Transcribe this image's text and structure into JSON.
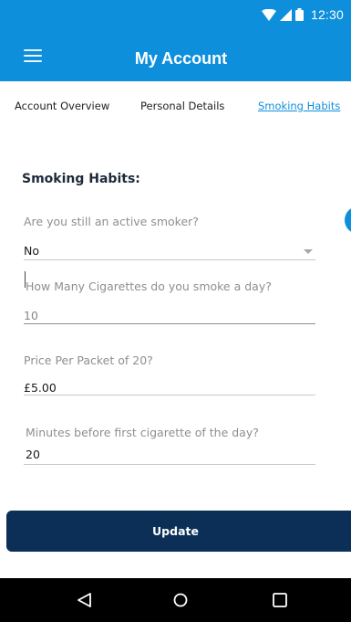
{
  "status_bar": {
    "time": "12:30",
    "icons": [
      "wifi-icon",
      "cellular-signal-icon",
      "battery-icon"
    ]
  },
  "app_bar": {
    "title": "My Account",
    "menu_icon": "hamburger-menu-icon"
  },
  "tabs": [
    {
      "label": "Account Overview",
      "active": false
    },
    {
      "label": "Personal Details",
      "active": false
    },
    {
      "label": "Smoking Habits",
      "active": true
    }
  ],
  "section": {
    "title": "Smoking Habits:"
  },
  "form": {
    "active_smoker": {
      "label": "Are you still an active smoker?",
      "value": "No"
    },
    "cigarettes_per_day": {
      "label": "How Many Cigarettes do you smoke a day?",
      "value": "10"
    },
    "price_per_packet": {
      "label": "Price Per Packet of 20?",
      "value": "£5.00"
    },
    "minutes_before_first": {
      "label": "Minutes before first cigarette of the day?",
      "value": "20"
    }
  },
  "actions": {
    "update_label": "Update"
  },
  "nav_bar": {
    "icons": [
      "back-icon",
      "home-icon",
      "recent-apps-icon"
    ]
  },
  "colors": {
    "primary": "#0e8fdc",
    "button": "#0b2f57",
    "nav_bar": "#000000"
  }
}
